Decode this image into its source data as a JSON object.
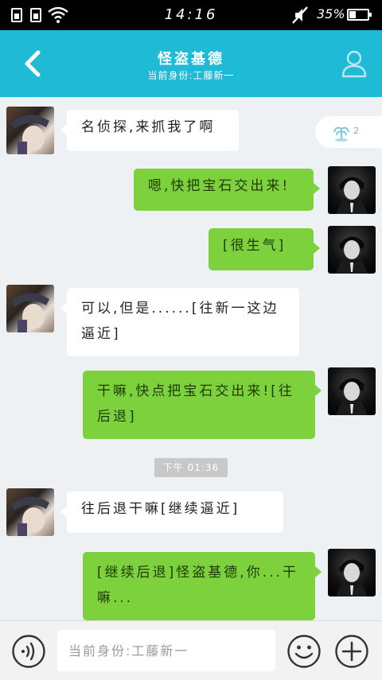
{
  "status_bar": {
    "time": "14:16",
    "battery_percent": "35%",
    "battery_level": 0.35,
    "icons": [
      "sim-icon",
      "sim-icon",
      "wifi-icon",
      "mute-icon",
      "battery-icon"
    ]
  },
  "header": {
    "title": "怪盗基德",
    "subtitle": "当前身份:工藤新一",
    "back_icon": "back-chevron-icon",
    "profile_icon": "profile-icon",
    "background_color": "#1fbad6"
  },
  "chat": {
    "messages": [
      {
        "side": "in",
        "sender_avatar": "kid-avatar",
        "text": "名侦探,来抓我了啊"
      },
      {
        "side": "out",
        "sender_avatar": "shinichi-avatar",
        "text": "嗯,快把宝石交出来!"
      },
      {
        "side": "out",
        "sender_avatar": "shinichi-avatar",
        "text": "[很生气]"
      },
      {
        "side": "in",
        "sender_avatar": "kid-avatar",
        "text": "可以,但是......[往新一这边逼近]"
      },
      {
        "side": "out",
        "sender_avatar": "shinichi-avatar",
        "text": "干嘛,快点把宝石交出来![往后退]"
      },
      {
        "side": "in",
        "sender_avatar": "kid-avatar",
        "text": "往后退干嘛[继续逼近]"
      },
      {
        "side": "out",
        "sender_avatar": "shinichi-avatar",
        "text": "[继续后退]怪盗基德,你...干嘛..."
      }
    ],
    "timestamp": "下午 01:36",
    "floating_widget": {
      "icon": "fountain-icon",
      "count": "2"
    },
    "outgoing_color": "#7dd13d",
    "incoming_color": "#ffffff"
  },
  "input_bar": {
    "placeholder": "当前身份:工藤新一",
    "value": "",
    "voice_icon": "voice-icon",
    "emoji_icon": "emoji-icon",
    "plus_icon": "plus-icon"
  }
}
